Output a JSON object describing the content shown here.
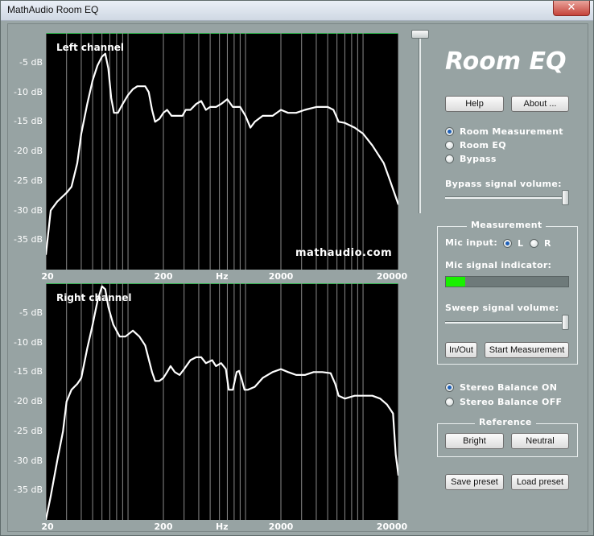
{
  "window": {
    "title": "MathAudio Room EQ",
    "close_glyph": "✕"
  },
  "app_title": "Room EQ",
  "buttons": {
    "help": "Help",
    "about": "About ...",
    "in_out": "In/Out",
    "start_measurement": "Start Measurement",
    "bright": "Bright",
    "neutral": "Neutral",
    "save_preset": "Save preset",
    "load_preset": "Load preset"
  },
  "mode": {
    "options": [
      "Room Measurement",
      "Room EQ",
      "Bypass"
    ],
    "selected": "Room Measurement"
  },
  "bypass_volume": {
    "label": "Bypass signal volume:",
    "value": 1.0
  },
  "master_volume": {
    "value": 1.0
  },
  "measurement": {
    "group_title": "Measurement",
    "mic_input_label": "Mic input:",
    "mic_options": [
      "L",
      "R"
    ],
    "mic_selected": "L",
    "indicator_label": "Mic signal indicator:",
    "indicator_level": 0.16,
    "sweep_label": "Sweep signal volume:",
    "sweep_value": 1.0
  },
  "stereo_balance": {
    "options": [
      "Stereo Balance ON",
      "Stereo Balance OFF"
    ],
    "selected": "Stereo Balance ON"
  },
  "reference": {
    "group_title": "Reference"
  },
  "colors": {
    "panel": "#97a3a3",
    "plot_bg": "#000000",
    "curve": "#ffffff",
    "grid": "#8a8a8a",
    "meter": "#19f000",
    "radio_dot": "#1d5fb8"
  },
  "chart_data": [
    {
      "type": "line",
      "title": "Left channel",
      "watermark": "mathaudio.com",
      "xlabel": "Hz",
      "x_scale": "log",
      "xlim": [
        20,
        20000
      ],
      "ylim": [
        -40,
        0
      ],
      "x_tick_labels": [
        "20",
        "200",
        "Hz",
        "2000",
        "20000"
      ],
      "y_ticks": [
        -5,
        -10,
        -15,
        -20,
        -25,
        -30,
        -35
      ],
      "y_tick_labels": [
        "-5 dB",
        "-10 dB",
        "-15 dB",
        "-20 dB",
        "-25 dB",
        "-30 dB",
        "-35 dB"
      ],
      "series": [
        {
          "points": [
            [
              20,
              -37.5
            ],
            [
              22,
              -30
            ],
            [
              25,
              -28.5
            ],
            [
              30,
              -27
            ],
            [
              33,
              -26
            ],
            [
              37,
              -22
            ],
            [
              40,
              -17
            ],
            [
              45,
              -12
            ],
            [
              50,
              -8
            ],
            [
              55,
              -5.5
            ],
            [
              60,
              -4
            ],
            [
              64,
              -3.5
            ],
            [
              68,
              -6
            ],
            [
              72,
              -11
            ],
            [
              76,
              -13.5
            ],
            [
              82,
              -13.5
            ],
            [
              90,
              -12
            ],
            [
              100,
              -10.5
            ],
            [
              110,
              -9.5
            ],
            [
              120,
              -9
            ],
            [
              140,
              -9
            ],
            [
              150,
              -10
            ],
            [
              160,
              -13
            ],
            [
              170,
              -15
            ],
            [
              185,
              -14.5
            ],
            [
              200,
              -13.5
            ],
            [
              215,
              -13
            ],
            [
              235,
              -14
            ],
            [
              260,
              -14
            ],
            [
              290,
              -14
            ],
            [
              310,
              -13
            ],
            [
              340,
              -13
            ],
            [
              380,
              -12
            ],
            [
              420,
              -11.5
            ],
            [
              460,
              -13
            ],
            [
              500,
              -12.5
            ],
            [
              560,
              -12.5
            ],
            [
              620,
              -12
            ],
            [
              700,
              -11.2
            ],
            [
              780,
              -12.5
            ],
            [
              900,
              -12.5
            ],
            [
              1000,
              -14
            ],
            [
              1100,
              -16
            ],
            [
              1200,
              -15
            ],
            [
              1400,
              -14
            ],
            [
              1700,
              -14
            ],
            [
              2000,
              -13
            ],
            [
              2300,
              -13.5
            ],
            [
              2700,
              -13.5
            ],
            [
              3200,
              -13
            ],
            [
              4000,
              -12.5
            ],
            [
              5000,
              -12.5
            ],
            [
              5600,
              -13
            ],
            [
              6200,
              -15
            ],
            [
              7000,
              -15.2
            ],
            [
              8500,
              -16
            ],
            [
              10000,
              -17
            ],
            [
              12000,
              -19
            ],
            [
              15000,
              -22
            ],
            [
              17000,
              -25
            ],
            [
              20000,
              -29
            ]
          ]
        }
      ]
    },
    {
      "type": "line",
      "title": "Right channel",
      "xlabel": "Hz",
      "x_scale": "log",
      "xlim": [
        20,
        20000
      ],
      "ylim": [
        -40,
        0
      ],
      "x_tick_labels": [
        "20",
        "200",
        "Hz",
        "2000",
        "20000"
      ],
      "y_ticks": [
        -5,
        -10,
        -15,
        -20,
        -25,
        -30,
        -35
      ],
      "y_tick_labels": [
        "-5 dB",
        "-10 dB",
        "-15 dB",
        "-20 dB",
        "-25 dB",
        "-30 dB",
        "-35 dB"
      ],
      "series": [
        {
          "points": [
            [
              20,
              -40
            ],
            [
              22,
              -36
            ],
            [
              25,
              -30
            ],
            [
              28,
              -25
            ],
            [
              30,
              -20
            ],
            [
              33,
              -18
            ],
            [
              37,
              -17
            ],
            [
              40,
              -16
            ],
            [
              45,
              -11
            ],
            [
              50,
              -7
            ],
            [
              55,
              -3
            ],
            [
              60,
              -0.5
            ],
            [
              64,
              -1
            ],
            [
              68,
              -4
            ],
            [
              75,
              -7
            ],
            [
              85,
              -9
            ],
            [
              95,
              -9
            ],
            [
              110,
              -8
            ],
            [
              125,
              -9
            ],
            [
              140,
              -10.5
            ],
            [
              160,
              -15
            ],
            [
              170,
              -16.5
            ],
            [
              185,
              -16.5
            ],
            [
              200,
              -16
            ],
            [
              215,
              -15
            ],
            [
              230,
              -14
            ],
            [
              250,
              -15
            ],
            [
              275,
              -15.5
            ],
            [
              300,
              -14.5
            ],
            [
              340,
              -13
            ],
            [
              380,
              -12.5
            ],
            [
              420,
              -12.5
            ],
            [
              460,
              -13.5
            ],
            [
              520,
              -13
            ],
            [
              560,
              -14
            ],
            [
              620,
              -13.5
            ],
            [
              680,
              -14.5
            ],
            [
              720,
              -18
            ],
            [
              780,
              -18
            ],
            [
              840,
              -15
            ],
            [
              880,
              -14.8
            ],
            [
              920,
              -16
            ],
            [
              980,
              -18
            ],
            [
              1050,
              -18
            ],
            [
              1200,
              -17.5
            ],
            [
              1400,
              -16
            ],
            [
              1700,
              -15
            ],
            [
              2000,
              -14.5
            ],
            [
              2300,
              -15
            ],
            [
              2700,
              -15.5
            ],
            [
              3200,
              -15.5
            ],
            [
              3800,
              -15
            ],
            [
              4500,
              -15
            ],
            [
              5300,
              -15.2
            ],
            [
              5800,
              -17
            ],
            [
              6200,
              -19
            ],
            [
              7000,
              -19.5
            ],
            [
              8500,
              -19
            ],
            [
              10000,
              -19
            ],
            [
              12000,
              -19
            ],
            [
              14000,
              -19.5
            ],
            [
              16000,
              -20.5
            ],
            [
              18000,
              -22
            ],
            [
              19000,
              -29
            ],
            [
              20000,
              -32.5
            ]
          ]
        }
      ]
    }
  ]
}
